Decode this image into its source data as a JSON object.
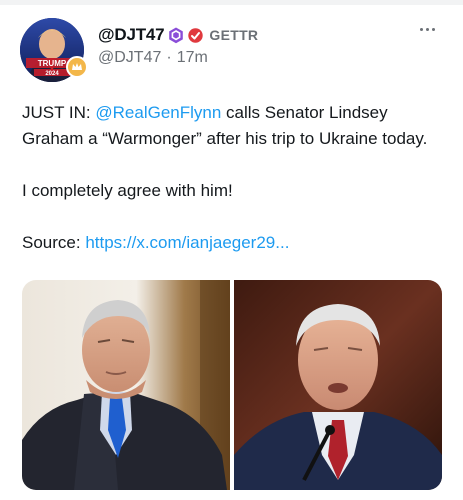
{
  "post": {
    "author_name": "@DJT47",
    "platform_label": "GETTR",
    "handle": "@DJT47",
    "separator": "·",
    "timestamp": "17m",
    "text_lead": "JUST IN: ",
    "mention": "@RealGenFlynn",
    "text_rest": " calls Senator Lindsey Graham a “Warmonger” after his trip to Ukraine today.",
    "line2": "I completely agree with him!",
    "source_label": "Source: ",
    "source_link": "https://x.com/ianjaeger29..."
  },
  "colors": {
    "link": "#1d9bf0",
    "verified_purple": "#8a4dd8",
    "gettr_red": "#e0393e",
    "muted": "#6b7076"
  },
  "icons": [
    "avatar",
    "crown-icon",
    "verified-badge-icon",
    "gettr-logo-icon",
    "more-options-icon"
  ]
}
